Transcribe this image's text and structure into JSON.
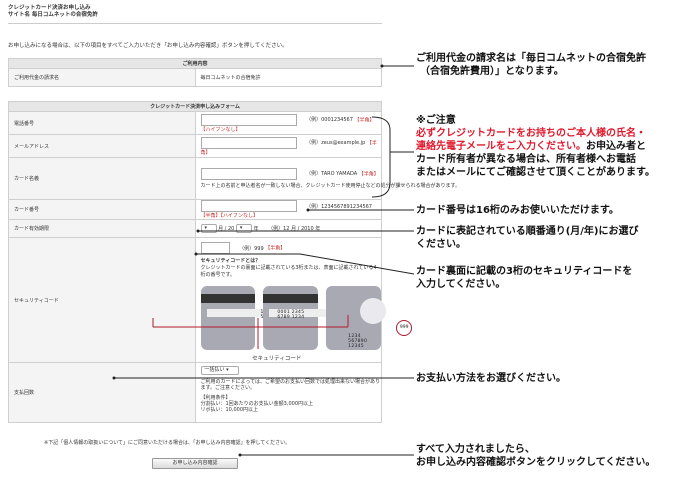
{
  "header": {
    "title": "クレジットカード決済お申し込み",
    "subtitle": "サイト名 毎日コムネットの合宿免許"
  },
  "intro": "お申し込みになる場合は、以下の項目をすべてご入力いただき「お申し込み内容確認」ボタンを押してください。",
  "usage": {
    "section_title": "ご利用内容",
    "label": "ご利用代金の請求名",
    "value": "毎日コムネットの合宿免許"
  },
  "form": {
    "section_title": "クレジットカード決済申し込みフォーム",
    "phone": {
      "label": "電話番号",
      "example": "（例）0001234567",
      "required": "【半角】【ハイフンなし】"
    },
    "email": {
      "label": "メールアドレス",
      "example": "（例）zeus@example.jp",
      "required": "【半角】"
    },
    "name": {
      "label": "カード名義",
      "example": "（例）TARO YAMADA",
      "required": "【半角】",
      "note": "カード上の名前と申込者名が一致しない場合、クレジットカード使用停止などの処分が課せられる場合があります。"
    },
    "card_number": {
      "label": "カード番号",
      "example": "（例）1234567891234567",
      "required": "【半角】【ハイフンなし】"
    },
    "expiry": {
      "label": "カード有効期限",
      "month": "月 / 20",
      "year_unit": "年",
      "example": "（例）12 月 / 2010 年"
    },
    "security": {
      "label": "セキュリティコード",
      "example": "（例）999",
      "required": "【半角】",
      "whatis_title": "セキュリティコードとは？",
      "whatis_desc": "クレジットカードの裏面に記載されている3桁または、表面に記載されている4桁の番号です。",
      "card1_number": "1234 567890",
      "card1_code": "999",
      "card2_number": "0001 2345 6789 1234",
      "card2_code": "999",
      "card3_number": "1234 567890 12345",
      "card3_code": "999",
      "caption": "セキュリティコード"
    },
    "payment": {
      "label": "支払回数",
      "select_value": "一括払い",
      "note": "ご利用のカードによっては、ご希望のお支払い回数では処理出来ない場合があります。ご注意ください。",
      "conditions_title": "【利用条件】",
      "condition1": "分割払い：1回あたりのお支払い金額3,000円以上",
      "condition2": "リボ払い：10,000円以上"
    }
  },
  "privacy_note": "※下記「個人情報の取扱いについて」にご同意いただける場合は、「お申し込み内容確認」を押してください。",
  "submit_label": "お申し込み内容確認",
  "annotations": {
    "billing": [
      "ご利用代金の請求名は「毎日コムネットの合宿免許",
      "（合宿免許費用）」となります。"
    ],
    "caution_title": "※ご注意",
    "caution_red": [
      "必ずクレジットカードをお持ちのご本人様の氏名・",
      "連絡先電子メールをご入力ください。"
    ],
    "caution_rest_inline": "お申込み者と",
    "caution_black": [
      "カード所有者が異なる場合は、所有者様へお電話",
      "またはメールにてご確認させて頂くことがあります。"
    ],
    "card_number": "カード番号は16桁のみお使いいただけます。",
    "expiry": [
      "カードに表記されている順番通り(月/年)にお選び",
      "ください。"
    ],
    "security": [
      "カード裏面に記載の3桁のセキュリティコードを",
      "入力してください。"
    ],
    "payment": "お支払い方法をお選びください。",
    "submit": [
      "すべて入力されましたら、",
      "お申し込み内容確認ボタンをクリックしてください。"
    ]
  },
  "colors": {
    "required_red": "#cc2b2b",
    "caution_red": "#e0192c",
    "ring_red": "#b01a2a",
    "header_gray": "#e6e6e6"
  }
}
